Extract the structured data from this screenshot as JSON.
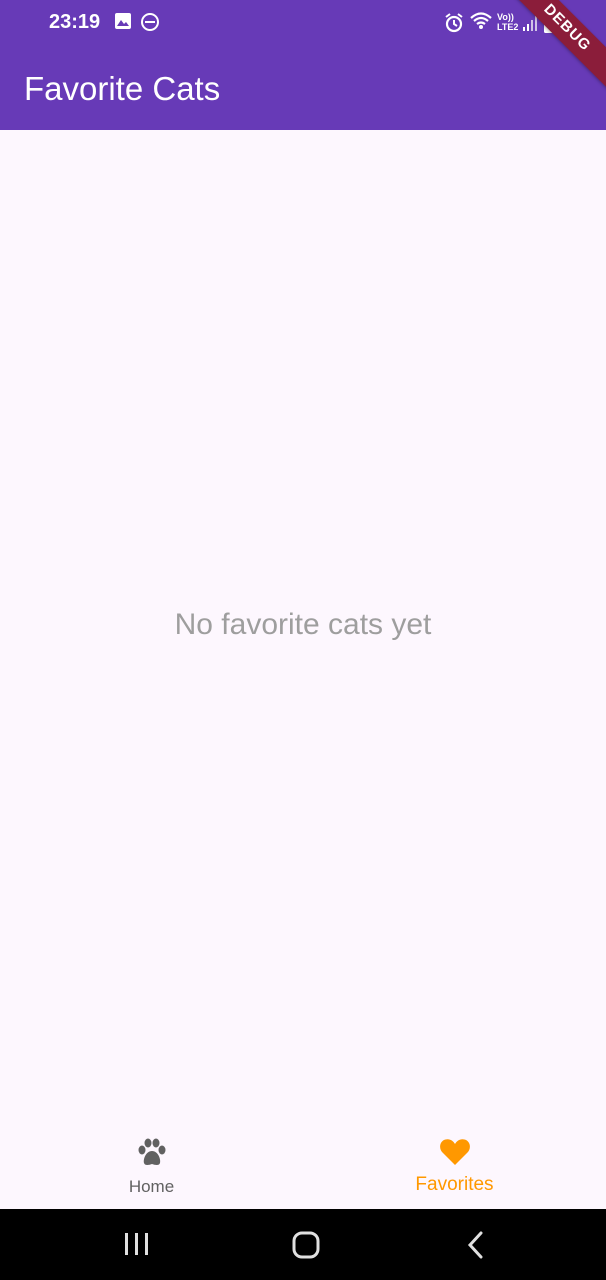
{
  "status_bar": {
    "time": "23:19",
    "network_label": "LTE2",
    "volte_label": "Vo))"
  },
  "app_bar": {
    "title": "Favorite Cats",
    "debug_banner": "DEBUG"
  },
  "main": {
    "empty_message": "No favorite cats yet"
  },
  "bottom_nav": {
    "items": [
      {
        "label": "Home",
        "icon": "paw-icon",
        "selected": false
      },
      {
        "label": "Favorites",
        "icon": "heart-icon",
        "selected": true
      }
    ],
    "selected_color": "#ff9800",
    "unselected_color": "#616161"
  },
  "system_nav": {
    "buttons": [
      "recent-apps",
      "home",
      "back"
    ]
  },
  "colors": {
    "app_bar": "#673ab7",
    "background": "#fdf7fe",
    "empty_text": "#9e9e9e"
  }
}
